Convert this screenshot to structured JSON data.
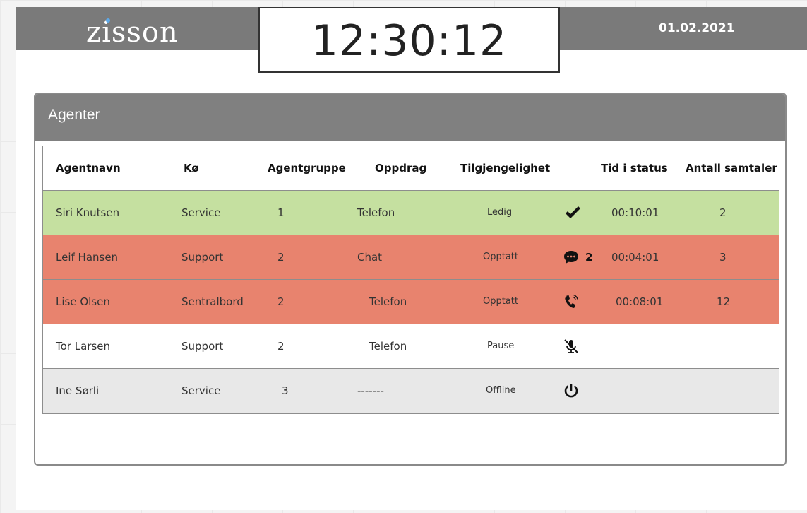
{
  "header": {
    "logo": "zisson",
    "clock": "12:30:12",
    "date": "01.02.2021"
  },
  "panel": {
    "title": "Agenter"
  },
  "table": {
    "columns": [
      "Agentnavn",
      "Kø",
      "Agentgruppe",
      "Oppdrag",
      "Tilgjengelighet",
      "Tid i status",
      "Antall samtaler"
    ],
    "rows": [
      {
        "name": "Siri Knutsen",
        "queue": "Service",
        "group": "1",
        "task": "Telefon",
        "availability": "Ledig",
        "icon": "checkmark-icon",
        "chat_count": "",
        "time": "00:10:01",
        "calls": "2",
        "bg": "#c5e0a0"
      },
      {
        "name": "Leif Hansen",
        "queue": "Support",
        "group": "2",
        "task": "Chat",
        "availability": "Opptatt",
        "icon": "chat-bubble-icon",
        "chat_count": "2",
        "time": "00:04:01",
        "calls": "3",
        "bg": "#e8836e"
      },
      {
        "name": "Lise Olsen",
        "queue": "Sentralbord",
        "group": "2",
        "task": "Telefon",
        "availability": "Opptatt",
        "icon": "phone-ringing-icon",
        "chat_count": "",
        "time": "00:08:01",
        "calls": "12",
        "bg": "#e8836e"
      },
      {
        "name": "Tor Larsen",
        "queue": "Support",
        "group": "2",
        "task": "Telefon",
        "availability": "Pause",
        "icon": "microphone-muted-icon",
        "chat_count": "",
        "time": "",
        "calls": "",
        "bg": "#ffffff"
      },
      {
        "name": "Ine Sørli",
        "queue": "Service",
        "group": "3",
        "task": "-------",
        "availability": "Offline",
        "icon": "power-icon",
        "chat_count": "",
        "time": "",
        "calls": "",
        "bg": "#e8e8e8"
      }
    ]
  },
  "colors": {
    "header_gray": "#7a7a7a",
    "available_green": "#c5e0a0",
    "busy_red": "#e8836e",
    "offline_gray": "#e8e8e8",
    "logo_dot_blue": "#5da9e9"
  }
}
